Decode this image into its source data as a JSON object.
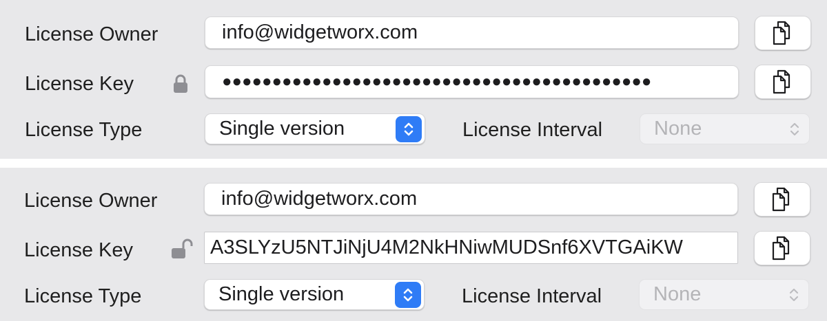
{
  "locked_panel": {
    "owner_label": "License Owner",
    "owner_value": "info@widgetworx.com",
    "key_label": "License Key",
    "key_masked": "●●●●●●●●●●●●●●●●●●●●●●●●●●●●●●●●●●●●●●●●●●●",
    "type_label": "License Type",
    "type_value": "Single version",
    "interval_label": "License Interval",
    "interval_value": "None",
    "lock_icon": "lock-closed-icon",
    "copy_icon": "copy-icon"
  },
  "unlocked_panel": {
    "owner_label": "License Owner",
    "owner_value": "info@widgetworx.com",
    "key_label": "License Key",
    "key_value": "A3SLYzU5NTJiNjU4M2NkHNiwMUDSnf6XVTGAiKW",
    "type_label": "License Type",
    "type_value": "Single version",
    "interval_label": "License Interval",
    "interval_value": "None",
    "lock_icon": "lock-open-icon",
    "copy_icon": "copy-icon"
  },
  "colors": {
    "panel_bg": "#e8e8ea",
    "accent": "#2f7cf6",
    "disabled_text": "#b4b4b7",
    "lock_gray": "#8e8e93"
  }
}
